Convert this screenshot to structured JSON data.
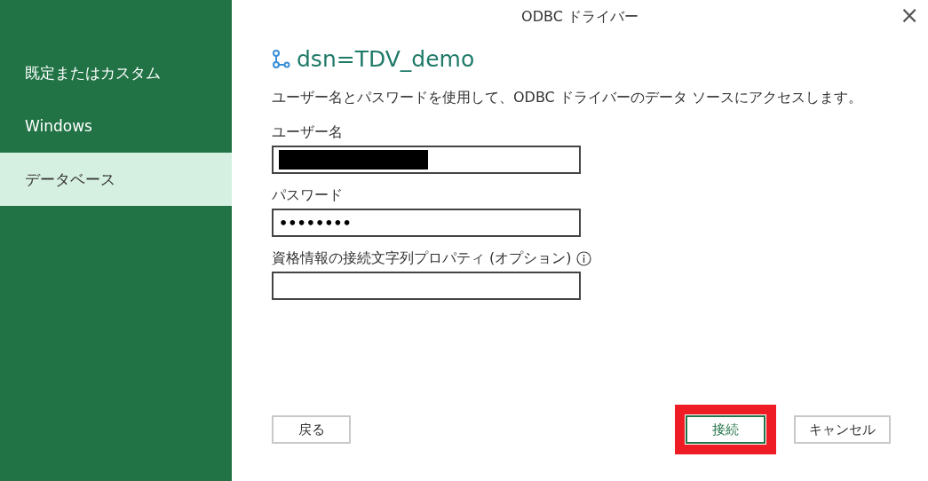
{
  "window": {
    "title": "ODBC ドライバー",
    "close": "×"
  },
  "sidebar": {
    "items": [
      {
        "label": "既定またはカスタム",
        "selected": false
      },
      {
        "label": "Windows",
        "selected": false
      },
      {
        "label": "データベース",
        "selected": true
      }
    ]
  },
  "heading": "dsn=TDV_demo",
  "description": "ユーザー名とパスワードを使用して、ODBC ドライバーのデータ ソースにアクセスします。",
  "fields": [
    {
      "label": "ユーザー名",
      "kind": "redacted"
    },
    {
      "label": "パスワード",
      "kind": "password",
      "value": "••••••••"
    },
    {
      "label": "資格情報の接続文字列プロパティ (オプション)",
      "kind": "empty",
      "info": true
    }
  ],
  "buttons": [
    {
      "label": "戻る",
      "kind": "back",
      "highlighted": false
    },
    {
      "label": "接続",
      "kind": "primary",
      "highlighted": true
    },
    {
      "label": "キャンセル",
      "kind": "secondary",
      "highlighted": false
    }
  ]
}
